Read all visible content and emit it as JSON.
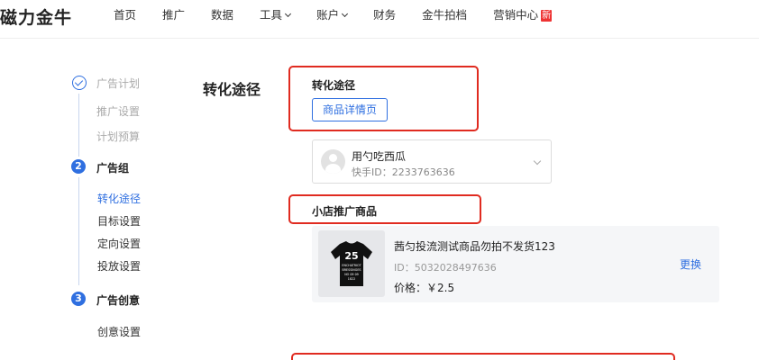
{
  "brand": "磁力金牛",
  "nav": {
    "items": [
      "首页",
      "推广",
      "数据",
      "工具",
      "账户",
      "财务",
      "金牛拍档",
      "营销中心"
    ],
    "new_badge": "新"
  },
  "steps": {
    "plan": {
      "title": "广告计划",
      "subs": [
        "推广设置",
        "计划预算"
      ]
    },
    "group": {
      "num": "2",
      "title": "广告组",
      "subs": [
        "转化途径",
        "目标设置",
        "定向设置",
        "投放设置"
      ]
    },
    "creative": {
      "num": "3",
      "title": "广告创意",
      "subs": [
        "创意设置"
      ]
    }
  },
  "main": {
    "section_title": "转化途径",
    "conversion_label": "转化途径",
    "conversion_button": "商品详情页",
    "account": {
      "name": "用勺吃西瓜",
      "id": "快手ID：2233763636"
    },
    "shop_label": "小店推广商品",
    "product": {
      "title": "茜匀投流测试商品勿拍不发货123",
      "id": "ID：5032028497636",
      "price": "价格：￥2.5",
      "swap": "更换",
      "shirt_text": [
        "25",
        "ENCHATRIOT",
        "BRESSINGES",
        "NO 09 09",
        "1822"
      ]
    }
  },
  "colors": {
    "accent": "#2f6fe0",
    "highlight": "#e02b20"
  }
}
